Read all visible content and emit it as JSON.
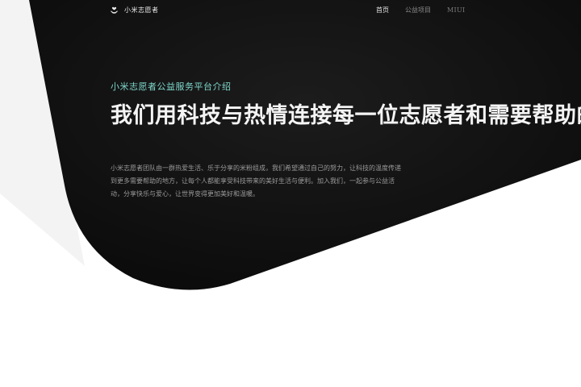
{
  "brand": {
    "name": "小米志愿者",
    "logo_icon": "heart-hand-icon"
  },
  "nav": {
    "links": [
      {
        "label": "首页",
        "active": true
      },
      {
        "label": "公益项目",
        "active": false
      },
      {
        "label": "MIUI",
        "active": false
      }
    ]
  },
  "hero": {
    "eyebrow": "小米志愿者公益服务平台介绍",
    "headline": "我们用科技与热情连接每一位志愿者和需要帮助的人",
    "description": "小米志愿者团队由一群热爱生活、乐于分享的米粉组成，我们希望通过自己的努力，让科技的温度传递到更多需要帮助的地方，让每个人都能享受科技带来的美好生活与便利。加入我们，一起参与公益活动，分享快乐与爱心，让世界变得更加美好和温暖。"
  },
  "colors": {
    "accent": "#7fd8cc",
    "hero_background": "#111111",
    "side_shape": "#f3f3f3"
  }
}
